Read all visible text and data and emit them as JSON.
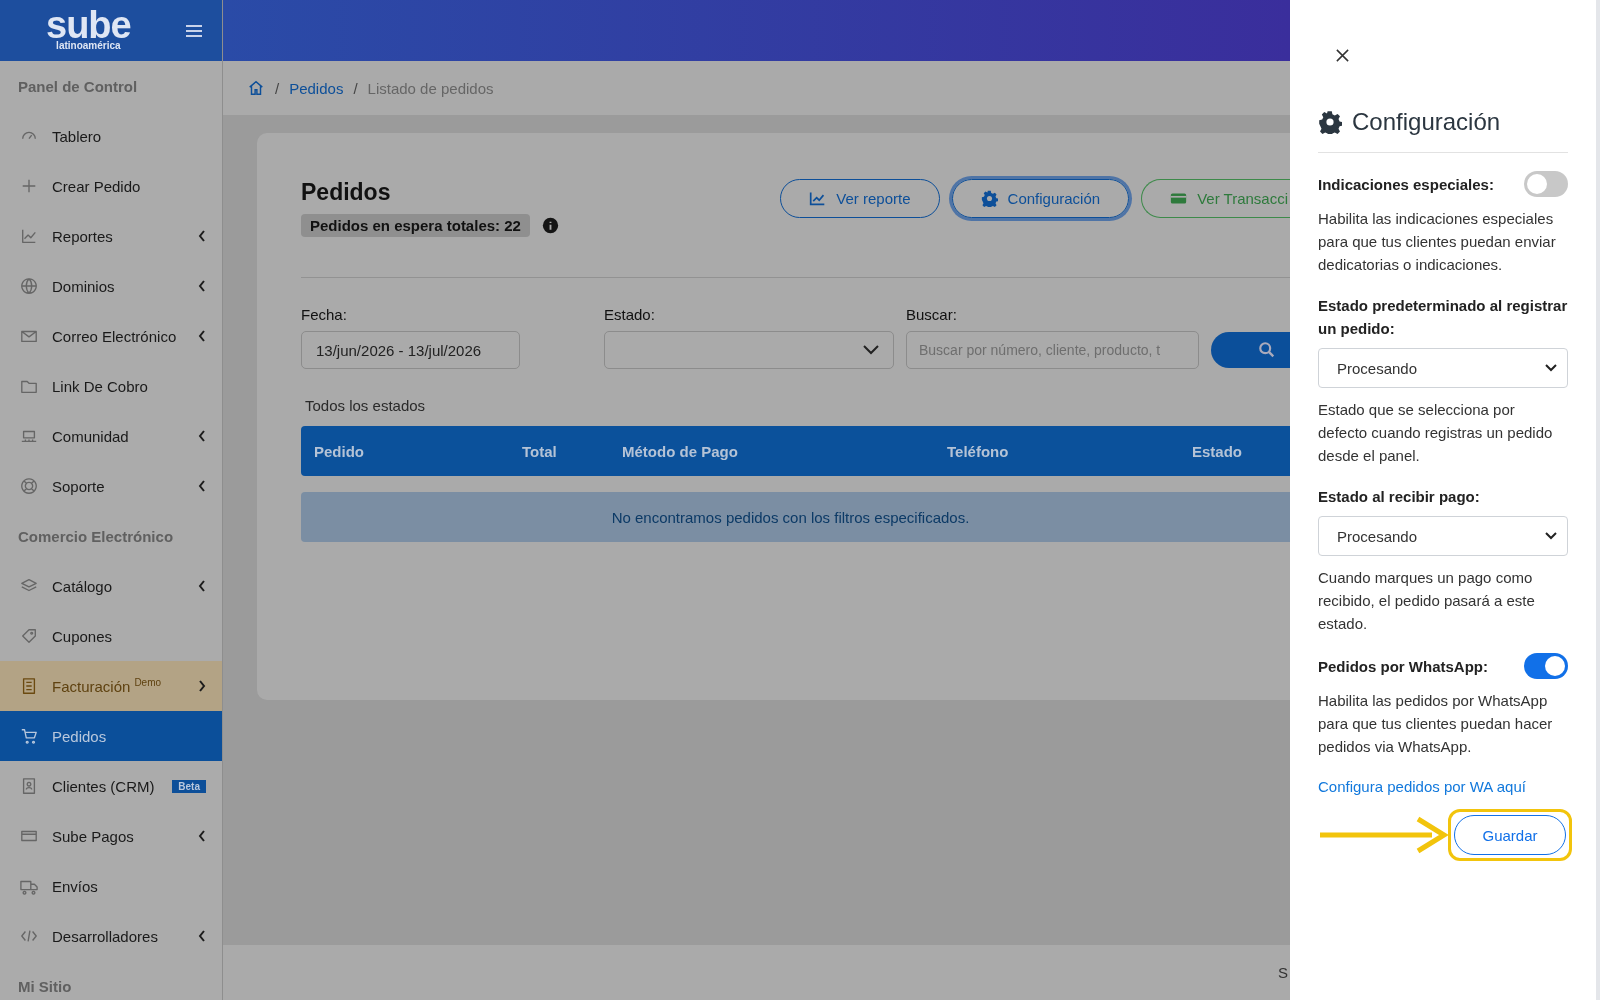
{
  "header": {
    "logo": "sube",
    "logo_subtitle": "latinoamérica"
  },
  "sidebar": {
    "sections": [
      {
        "heading": "Panel de Control",
        "items": [
          {
            "label": "Tablero",
            "kind": "plain",
            "selected": false,
            "highlighted": false
          },
          {
            "label": "Crear Pedido",
            "kind": "plain",
            "selected": false,
            "highlighted": false
          },
          {
            "label": "Reportes",
            "kind": "group",
            "selected": false,
            "highlighted": false
          },
          {
            "label": "Dominios",
            "kind": "group",
            "selected": false,
            "highlighted": false
          },
          {
            "label": "Correo Electrónico",
            "kind": "group",
            "selected": false,
            "highlighted": false
          },
          {
            "label": "Link De Cobro",
            "kind": "plain",
            "selected": false,
            "highlighted": false
          },
          {
            "label": "Comunidad",
            "kind": "group",
            "selected": false,
            "highlighted": false
          },
          {
            "label": "Soporte",
            "kind": "group",
            "selected": false,
            "highlighted": false
          }
        ]
      },
      {
        "heading": "Comercio Electrónico",
        "items": [
          {
            "label": "Catálogo",
            "kind": "group",
            "selected": false,
            "highlighted": false
          },
          {
            "label": "Cupones",
            "kind": "plain",
            "selected": false,
            "highlighted": false
          },
          {
            "label": "Facturación",
            "sup": "Demo",
            "kind": "forward",
            "selected": false,
            "highlighted": true
          },
          {
            "label": "Pedidos",
            "kind": "plain",
            "selected": true,
            "highlighted": false
          },
          {
            "label": "Clientes (CRM)",
            "badge": "Beta",
            "kind": "plain",
            "selected": false,
            "highlighted": false
          },
          {
            "label": "Sube Pagos",
            "kind": "group",
            "selected": false,
            "highlighted": false
          },
          {
            "label": "Envíos",
            "kind": "plain",
            "selected": false,
            "highlighted": false
          },
          {
            "label": "Desarrolladores",
            "kind": "group",
            "selected": false,
            "highlighted": false
          }
        ]
      },
      {
        "heading": "Mi Sitio"
      }
    ]
  },
  "breadcrumb": [
    {
      "separator": "/",
      "label": "Pedidos",
      "kind": "link"
    },
    {
      "separator": "/",
      "label": "Listado de pedidos",
      "kind": "current"
    }
  ],
  "page": {
    "title": "Pedidos",
    "pending_badge": "Pedidos en espera totales: 22",
    "buttons": [
      {
        "label": "Ver reporte",
        "kind": "report",
        "focused": false
      },
      {
        "label": "Configuración",
        "kind": "settings",
        "focused": true
      },
      {
        "label": "Ver Transacci",
        "kind": "transactions",
        "focused": false
      }
    ],
    "filters": {
      "date_label": "Fecha:",
      "date_value": "13/jun/2026 - 13/jul/2026",
      "status_label": "Estado:",
      "search_label": "Buscar:",
      "search_placeholder": "Buscar por número, cliente, producto, t"
    },
    "status_caption": "Todos los estados",
    "table": {
      "columns": [
        "Pedido",
        "Total",
        "Método de Pago",
        "Teléfono",
        "Estado"
      ],
      "empty_message": "No encontramos pedidos con los filtros especificados."
    }
  },
  "footer": {
    "text": "S"
  },
  "drawer": {
    "title": "Configuración",
    "settings": [
      {
        "kind": "toggle",
        "label": "Indicaciones especiales:",
        "on": false,
        "description": "Habilita las indicaciones especiales para que tus clientes puedan enviar dedicatorias o indicaciones."
      },
      {
        "kind": "select",
        "label": "Estado predeterminado al registrar un pedido:",
        "value": "Procesando",
        "description": "Estado que se selecciona por defecto cuando registras un pedido desde el panel."
      },
      {
        "kind": "select",
        "label": "Estado al recibir pago:",
        "value": "Procesando",
        "description": "Cuando marques un pago como recibido, el pedido pasará a este estado."
      },
      {
        "kind": "toggle",
        "label": "Pedidos por WhatsApp:",
        "on": true,
        "description": "Habilita las pedidos por WhatsApp para que tus clientes puedan hacer pedidos via WhatsApp."
      },
      {
        "kind": "link",
        "label": "Configura pedidos por WA aquí"
      }
    ],
    "save_button": "Guardar"
  }
}
